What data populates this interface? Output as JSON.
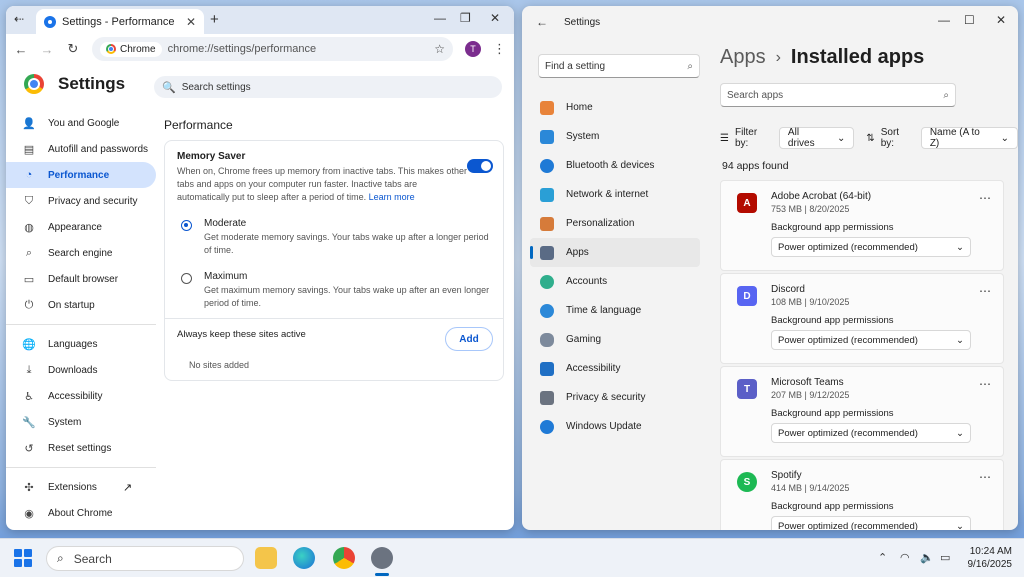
{
  "chrome": {
    "tab_title": "Settings - Performance",
    "omnibox_chip": "Chrome",
    "url": "chrome://settings/performance",
    "avatar_letter": "T",
    "settings_title": "Settings",
    "search_placeholder": "Search settings",
    "sidebar": [
      {
        "label": "You and Google",
        "icon": "person-icon"
      },
      {
        "label": "Autofill and passwords",
        "icon": "autofill-icon"
      },
      {
        "label": "Performance",
        "icon": "speedometer-icon",
        "active": true
      },
      {
        "label": "Privacy and security",
        "icon": "shield-icon"
      },
      {
        "label": "Appearance",
        "icon": "palette-icon"
      },
      {
        "label": "Search engine",
        "icon": "search-icon"
      },
      {
        "label": "Default browser",
        "icon": "browser-icon"
      },
      {
        "label": "On startup",
        "icon": "power-icon"
      },
      {
        "label": "Languages",
        "icon": "globe-icon"
      },
      {
        "label": "Downloads",
        "icon": "download-icon"
      },
      {
        "label": "Accessibility",
        "icon": "accessibility-icon"
      },
      {
        "label": "System",
        "icon": "wrench-icon"
      },
      {
        "label": "Reset settings",
        "icon": "reset-icon"
      },
      {
        "label": "Extensions",
        "icon": "puzzle-icon"
      },
      {
        "label": "About Chrome",
        "icon": "chrome-logo-icon"
      }
    ],
    "performance": {
      "heading": "Performance",
      "memory_saver": {
        "title": "Memory Saver",
        "description": "When on, Chrome frees up memory from inactive tabs. This makes other tabs and apps on your computer run faster. Inactive tabs are automatically put to sleep after a period of time.",
        "learn_more": "Learn more",
        "enabled": true
      },
      "options": [
        {
          "title": "Moderate",
          "description": "Get moderate memory savings. Your tabs wake up after a longer period of time.",
          "selected": true
        },
        {
          "title": "Maximum",
          "description": "Get maximum memory savings. Your tabs wake up after an even longer period of time.",
          "selected": false
        }
      ],
      "keep_active": {
        "title": "Always keep these sites active",
        "add_label": "Add",
        "empty": "No sites added"
      }
    }
  },
  "win_settings": {
    "app_title": "Settings",
    "find_placeholder": "Find a setting",
    "nav": [
      {
        "label": "Home",
        "color": "#e8833a"
      },
      {
        "label": "System",
        "color": "#2b88d8"
      },
      {
        "label": "Bluetooth & devices",
        "color": "#1f7ad6"
      },
      {
        "label": "Network & internet",
        "color": "#2a9fd6"
      },
      {
        "label": "Personalization",
        "color": "#d67b3a"
      },
      {
        "label": "Apps",
        "color": "#5a6b85",
        "active": true
      },
      {
        "label": "Accounts",
        "color": "#2fae8c"
      },
      {
        "label": "Time & language",
        "color": "#2b88d8"
      },
      {
        "label": "Gaming",
        "color": "#7d8a9c"
      },
      {
        "label": "Accessibility",
        "color": "#1f6fc4"
      },
      {
        "label": "Privacy & security",
        "color": "#6b7380"
      },
      {
        "label": "Windows Update",
        "color": "#1f7ad6"
      }
    ],
    "breadcrumb_parent": "Apps",
    "breadcrumb_sep": "›",
    "breadcrumb_current": "Installed apps",
    "search_apps_placeholder": "Search apps",
    "filter_label": "Filter by:",
    "filter_value": "All drives",
    "sort_label": "Sort by:",
    "sort_value": "Name (A to Z)",
    "count": "94 apps found",
    "apps": [
      {
        "name": "Adobe Acrobat (64-bit)",
        "meta": "753 MB  |  8/20/2025",
        "color": "#b30b00",
        "glyph": "A",
        "bg_label": "Background app permissions",
        "bg_value": "Power optimized (recommended)"
      },
      {
        "name": "Discord",
        "meta": "108 MB  |  9/10/2025",
        "color": "#5865f2",
        "glyph": "D",
        "bg_label": "Background app permissions",
        "bg_value": "Power optimized (recommended)"
      },
      {
        "name": "Microsoft Teams",
        "meta": "207 MB  |  9/12/2025",
        "color": "#5b5fc7",
        "glyph": "T",
        "bg_label": "Background app permissions",
        "bg_value": "Power optimized (recommended)"
      },
      {
        "name": "Spotify",
        "meta": "414 MB  |  9/14/2025",
        "color": "#1db954",
        "glyph": "S",
        "bg_label": "Background app permissions",
        "bg_value": "Power optimized (recommended)"
      }
    ]
  },
  "taskbar": {
    "search_label": "Search",
    "time": "10:24 AM",
    "date": "9/16/2025"
  }
}
